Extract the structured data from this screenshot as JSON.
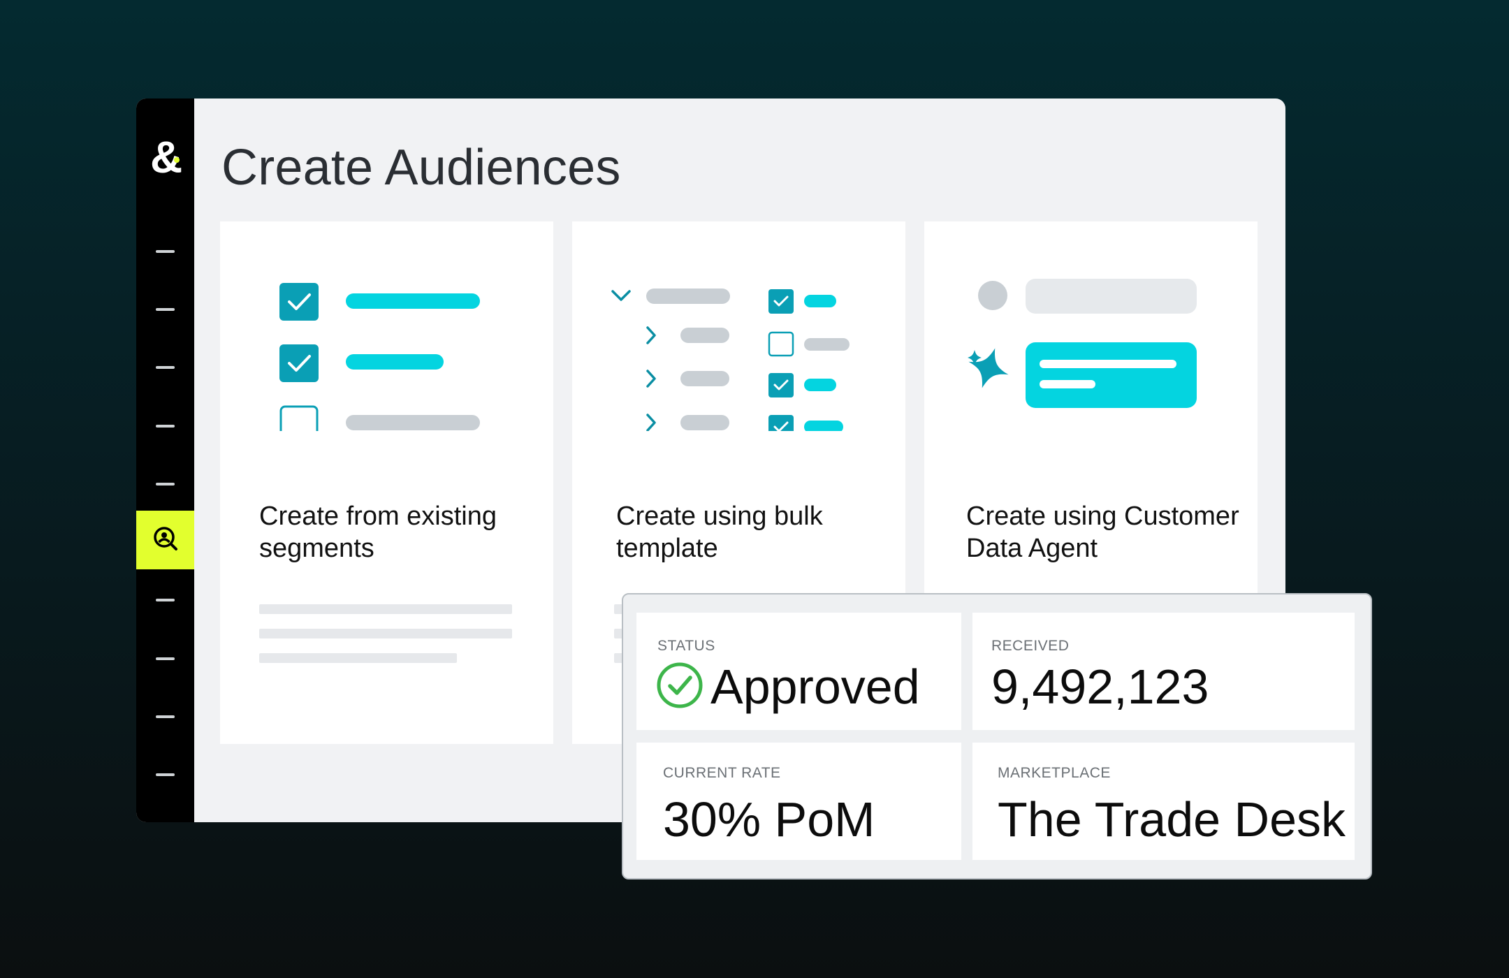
{
  "page": {
    "title": "Create Audiences"
  },
  "sidebar": {
    "logo": "&",
    "nav_items": [
      "dash-1",
      "dash-2",
      "dash-3",
      "dash-4",
      "dash-5",
      "audience-search",
      "dash-6",
      "dash-7",
      "dash-8",
      "dash-9"
    ],
    "active_item": "audience-search-icon",
    "active_color": "#e2ff2e"
  },
  "options": [
    {
      "title": "Create from existing segments",
      "illustration": "checklist-icon"
    },
    {
      "title": "Create using bulk template",
      "illustration": "tree-checklist-icon"
    },
    {
      "title": "Create using Customer Data Agent",
      "illustration": "ai-sparkle-chat-icon"
    }
  ],
  "stats": {
    "status": {
      "label": "STATUS",
      "value": "Approved",
      "icon": "check-circle-icon"
    },
    "received": {
      "label": "RECEIVED",
      "value": "9,492,123"
    },
    "current_rate": {
      "label": "CURRENT RATE",
      "value": "30% PoM"
    },
    "marketplace": {
      "label": "MARKETPLACE",
      "value": "The Trade Desk"
    }
  },
  "colors": {
    "accent_teal": "#0a9fb5",
    "accent_cyan": "#04d4e0",
    "placeholder_gray": "#c9cfd4",
    "approved_green": "#3db54a"
  }
}
